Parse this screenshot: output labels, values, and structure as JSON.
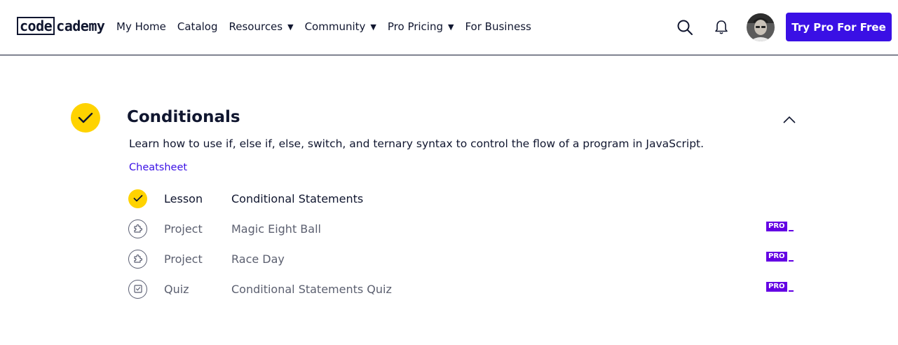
{
  "header": {
    "logo": {
      "part1": "code",
      "part2": "cademy"
    },
    "nav": [
      {
        "label": "My Home",
        "dropdown": false
      },
      {
        "label": "Catalog",
        "dropdown": false
      },
      {
        "label": "Resources",
        "dropdown": true
      },
      {
        "label": "Community",
        "dropdown": true
      },
      {
        "label": "Pro Pricing",
        "dropdown": true
      },
      {
        "label": "For Business",
        "dropdown": false
      }
    ],
    "cta_label": "Try Pro For Free",
    "icons": {
      "search": "search-icon",
      "notifications": "bell-icon",
      "avatar": "user-avatar"
    }
  },
  "module": {
    "title": "Conditionals",
    "completed": true,
    "expanded": true,
    "description": "Learn how to use if, else if, else, switch, and ternary syntax to control the flow of a program in JavaScript.",
    "cheatsheet_label": "Cheatsheet",
    "items": [
      {
        "type": "Lesson",
        "name": "Conditional Statements",
        "status": "complete",
        "icon": "check-icon",
        "pro": false
      },
      {
        "type": "Project",
        "name": "Magic Eight Ball",
        "status": "incomplete",
        "icon": "puzzle-icon",
        "pro": true
      },
      {
        "type": "Project",
        "name": "Race Day",
        "status": "incomplete",
        "icon": "puzzle-icon",
        "pro": true
      },
      {
        "type": "Quiz",
        "name": "Conditional Statements Quiz",
        "status": "incomplete",
        "icon": "quiz-icon",
        "pro": true
      }
    ],
    "pro_badge_label": "PRO"
  },
  "colors": {
    "brand_primary": "#3a10e5",
    "check_yellow": "#ffd300",
    "pro_purple": "#6400e4",
    "text_dark": "#10162f"
  }
}
